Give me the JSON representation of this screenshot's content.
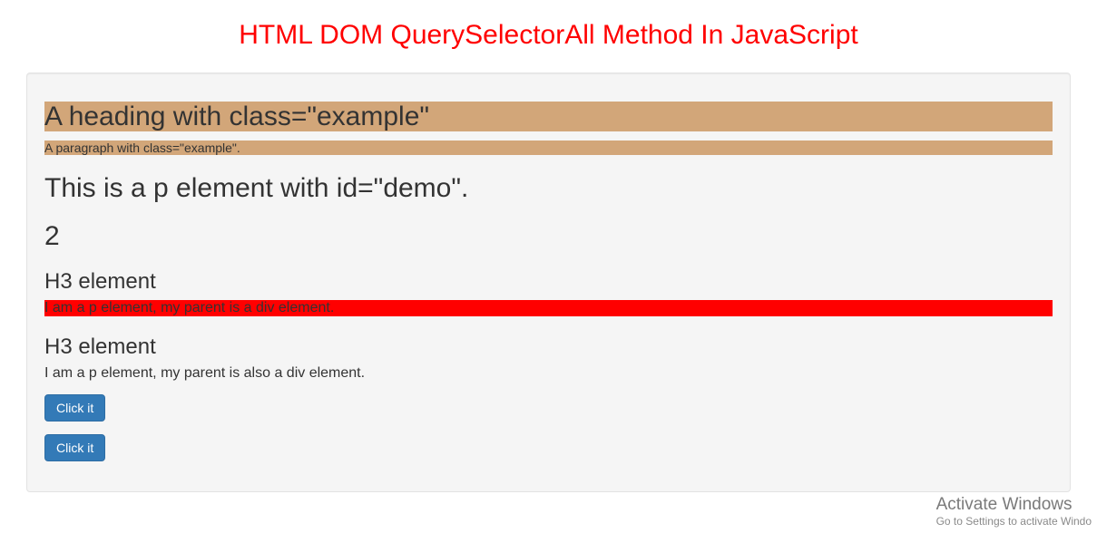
{
  "page": {
    "title": "HTML DOM QuerySelectorAll Method In JavaScript"
  },
  "content": {
    "heading_example": "A heading with class=\"example\"",
    "para_example": "A paragraph with class=\"example\".",
    "demo_text": "This is a p element with id=\"demo\".",
    "demo_count": "2",
    "section1": {
      "h3": "H3 element",
      "p": "I am a p element, my parent is a div element."
    },
    "section2": {
      "h3": "H3 element",
      "p": "I am a p element, my parent is also a div element."
    },
    "button1": "Click it",
    "button2": "Click it"
  },
  "watermark": {
    "title": "Activate Windows",
    "sub": "Go to Settings to activate Windo"
  }
}
